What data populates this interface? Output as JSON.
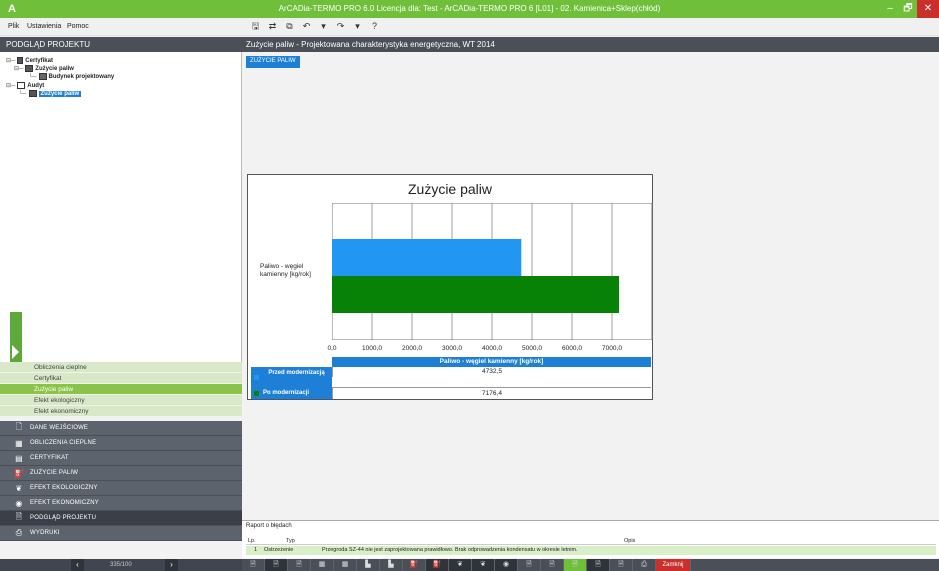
{
  "window": {
    "app_icon": "arcadia-logo-icon",
    "title": "ArCADia-TERMO PRO 6.0 Licencja dla: Test - ArCADia-TERMO PRO 6 [L01] - 02. Kamienica+Sklep(chłód)",
    "minimize": "‒",
    "maximize": "🗗",
    "close": "✕"
  },
  "menu": {
    "file": "Plik",
    "settings": "Ustawienia",
    "help": "Pomoc"
  },
  "toolbar": {
    "icons": [
      {
        "name": "save-icon",
        "glyph": "🖫"
      },
      {
        "name": "sync-icon",
        "glyph": "⇄"
      },
      {
        "name": "copy-icon",
        "glyph": "⧉"
      },
      {
        "name": "undo-icon",
        "glyph": "↶"
      },
      {
        "name": "dropdown-icon",
        "glyph": "▾"
      },
      {
        "name": "redo-icon",
        "glyph": "↷"
      },
      {
        "name": "dropdown-icon",
        "glyph": "▾"
      },
      {
        "name": "help-icon",
        "glyph": "?"
      }
    ]
  },
  "left_panel": {
    "header": "PODGLĄD PROJEKTU",
    "tree": {
      "certyfikat": "Certyfikat",
      "zuzycie_paliw": "Zużycie paliw",
      "budynek": "Budynek projektowany",
      "audyt": "Audyt",
      "audyt_zuzycie": "Zużycie paliw"
    },
    "subnav": [
      "Obliczenia cieplne",
      "Certyfikat",
      "Zużycie paliw",
      "Efekt ekologiczny",
      "Efekt ekonomiczny"
    ],
    "subnav_active": 2,
    "mainnav": [
      {
        "label": "DANE WEJŚCIOWE",
        "icon": "input-data-icon",
        "glyph": "🗋"
      },
      {
        "label": "OBLICZENIA CIEPLNE",
        "icon": "calculator-icon",
        "glyph": "▦"
      },
      {
        "label": "CERTYFIKAT",
        "icon": "certificate-icon",
        "glyph": "▤"
      },
      {
        "label": "ZUŻYCIE PALIW",
        "icon": "fuel-icon",
        "glyph": "⛽"
      },
      {
        "label": "EFEKT EKOLOGICZNY",
        "icon": "leaf-icon",
        "glyph": "❦"
      },
      {
        "label": "EFEKT EKONOMICZNY",
        "icon": "coin-icon",
        "glyph": "◉"
      },
      {
        "label": "PODGLĄD PROJEKTU",
        "icon": "preview-icon",
        "glyph": "🗎"
      },
      {
        "label": "WYDRUKI",
        "icon": "printer-icon",
        "glyph": "⎙"
      }
    ],
    "mainnav_active": 6,
    "pager": {
      "prev": "‹",
      "next": "›",
      "count": "335/100"
    }
  },
  "content": {
    "header": "Zużycie paliw - Projektowana charakterystyka energetyczna, WT 2014",
    "tab": "ZUŻYCIE PALIW"
  },
  "chart_data": {
    "type": "bar",
    "orientation": "horizontal",
    "title": "Zużycie paliw",
    "categories": [
      "Paliwo - węgiel kamienny [kg/rok]"
    ],
    "series": [
      {
        "name": "Przed modernizacją",
        "values": [
          4732.5
        ],
        "color": "#2196f3",
        "value_label": "4732,5"
      },
      {
        "name": "Po modernizacji",
        "values": [
          7176.4
        ],
        "color": "#078207",
        "value_label": "7176,4"
      }
    ],
    "xlim": [
      0,
      8000
    ],
    "ticks": [
      "0,0",
      "1000,0",
      "2000,0",
      "3000,0",
      "4000,0",
      "5000,0",
      "6000,0",
      "7000,0"
    ],
    "tick_values": [
      0,
      1000,
      2000,
      3000,
      4000,
      5000,
      6000,
      7000
    ],
    "grid": true,
    "table_header": "Paliwo - węgiel kamienny [kg/rok]"
  },
  "report": {
    "title": "Raport o błędach",
    "columns": {
      "lp": "Lp.",
      "typ": "Typ",
      "opis": "Opis"
    },
    "rows": [
      {
        "lp": "1",
        "typ": "Ostrzeżenie",
        "opis": "Przegroda SZ-44 nie jest zaprojektowana prawidłowo. Brak odprowadzenia kondensatu w okresie letnim."
      }
    ]
  },
  "bottombar": {
    "buttons": [
      {
        "name": "doc-icon",
        "glyph": "🗎",
        "style": ""
      },
      {
        "name": "doc-export-icon",
        "glyph": "🗎",
        "style": "dark"
      },
      {
        "name": "doc-copy-icon",
        "glyph": "🗎",
        "style": ""
      },
      {
        "name": "table-icon",
        "glyph": "▦",
        "style": ""
      },
      {
        "name": "table-alt-icon",
        "glyph": "▦",
        "style": ""
      },
      {
        "name": "chart-icon",
        "glyph": "▙",
        "style": ""
      },
      {
        "name": "chart-alt-icon",
        "glyph": "▙",
        "style": ""
      },
      {
        "name": "fuel-icon",
        "glyph": "⛽",
        "style": ""
      },
      {
        "name": "fuel-alt-icon",
        "glyph": "⛽",
        "style": "dark"
      },
      {
        "name": "leaf-icon",
        "glyph": "❦",
        "style": "dark"
      },
      {
        "name": "leaf-alt-icon",
        "glyph": "❦",
        "style": "dark"
      },
      {
        "name": "coin-icon",
        "glyph": "◉",
        "style": "dark"
      },
      {
        "name": "preview-icon",
        "glyph": "🗎",
        "style": ""
      },
      {
        "name": "preview-alt-icon",
        "glyph": "🗎",
        "style": ""
      },
      {
        "name": "preview-green-icon",
        "glyph": "🗎",
        "style": "green"
      },
      {
        "name": "preview-dark-icon",
        "glyph": "🗎",
        "style": "dark"
      },
      {
        "name": "preview-next-icon",
        "glyph": "🗎",
        "style": ""
      },
      {
        "name": "printer-icon",
        "glyph": "⎙",
        "style": ""
      }
    ],
    "close_label": "Zamknij"
  }
}
